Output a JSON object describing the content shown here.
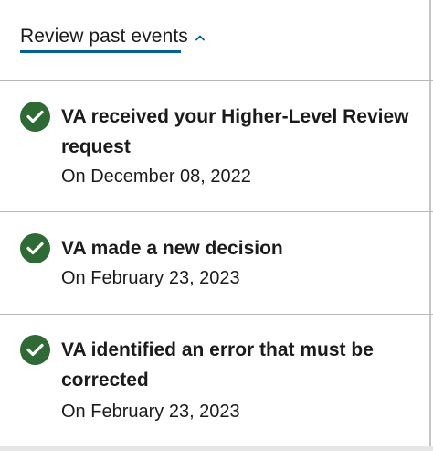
{
  "toggle": {
    "label": "Review past events",
    "icon": "chevron-up-icon",
    "accent_color": "#005ea2"
  },
  "events": [
    {
      "icon": "check-circle-icon",
      "title": "VA received your Higher-Level Review request",
      "date": "On December 08, 2022"
    },
    {
      "icon": "check-circle-icon",
      "title": "VA made a new decision",
      "date": "On February 23, 2023"
    },
    {
      "icon": "check-circle-icon",
      "title": "VA identified an error that must be corrected",
      "date": "On February 23, 2023"
    }
  ],
  "colors": {
    "success_green": "#2e6a33",
    "divider": "#b7b7b7",
    "text": "#1b1b1b"
  }
}
